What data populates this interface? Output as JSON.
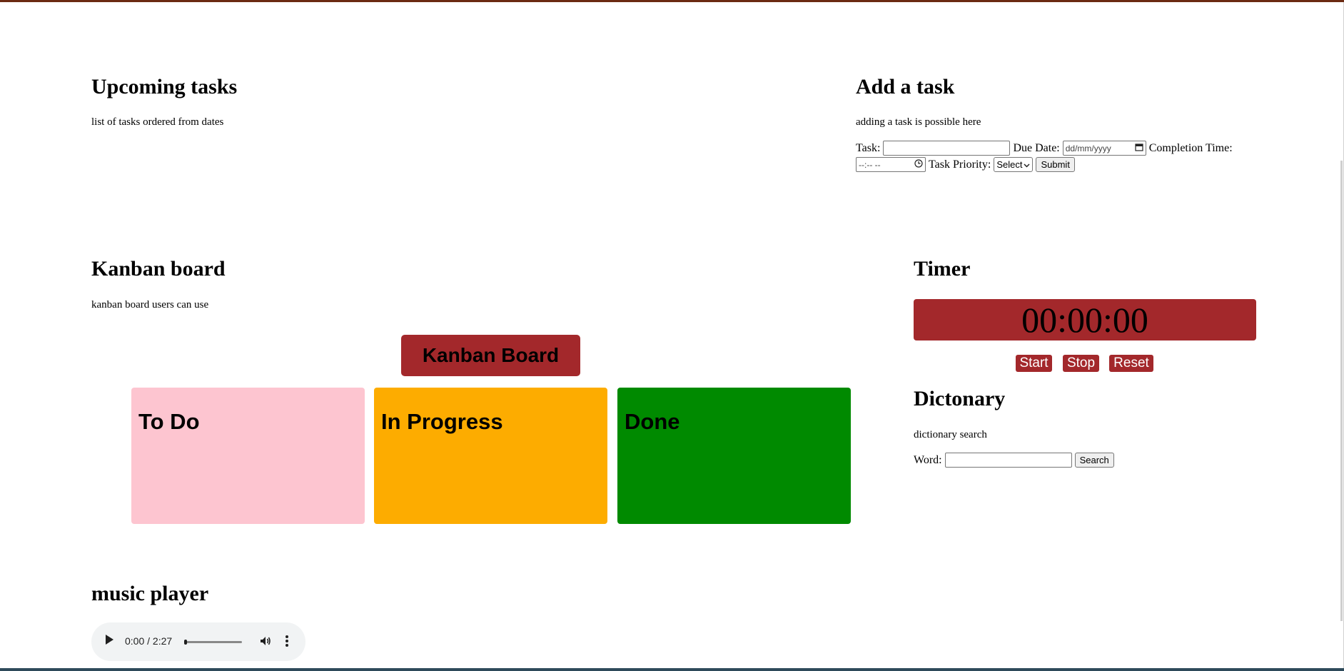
{
  "upcoming": {
    "title": "Upcoming tasks",
    "description": "list of tasks ordered from dates"
  },
  "add_task": {
    "title": "Add a task",
    "description": "adding a task is possible here",
    "task_label": "Task:",
    "task_value": "",
    "due_label": "Due Date:",
    "due_placeholder": "dd/mm/yyyy",
    "completion_label": "Completion Time:",
    "completion_placeholder": "--:-- --",
    "priority_label": "Task Priority:",
    "priority_selected": "Select",
    "submit_label": "Submit"
  },
  "kanban": {
    "title": "Kanban board",
    "description": "kanban board users can use",
    "board_header": "Kanban Board",
    "columns": [
      {
        "label": "To Do",
        "color": "#fdc5d0"
      },
      {
        "label": "In Progress",
        "color": "#fdac00"
      },
      {
        "label": "Done",
        "color": "#008a00"
      }
    ]
  },
  "timer": {
    "title": "Timer",
    "display": "00:00:00",
    "start_label": "Start",
    "stop_label": "Stop",
    "reset_label": "Reset",
    "accent": "#a3282b"
  },
  "dictionary": {
    "title": "Dictonary",
    "description": "dictionary search",
    "word_label": "Word:",
    "word_value": "",
    "search_label": "Search"
  },
  "music": {
    "title": "music player",
    "current_time": "0:00",
    "duration": "2:27",
    "progress": 0
  }
}
